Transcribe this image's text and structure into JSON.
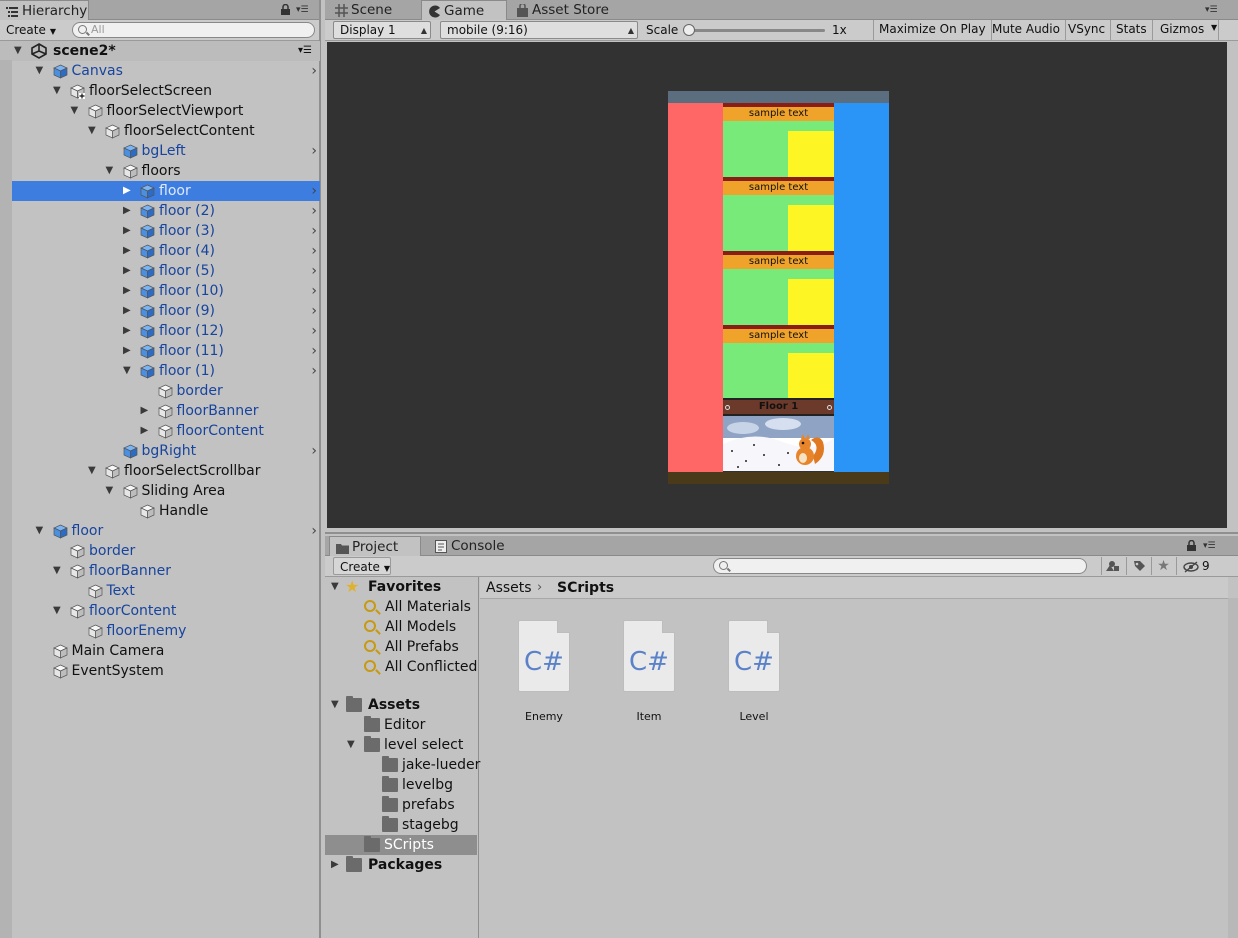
{
  "hierarchy": {
    "tab_label": "Hierarchy",
    "create_label": "Create",
    "search_placeholder": "All",
    "scene_name": "scene2*",
    "items": [
      {
        "label": "Canvas",
        "indent": 1,
        "fold": "open",
        "icon": "cube-blue",
        "prefab": true,
        "chev": true
      },
      {
        "label": "floorSelectScreen",
        "indent": 2,
        "fold": "open",
        "icon": "cube-gray-plus",
        "prefab": false,
        "chev": false
      },
      {
        "label": "floorSelectViewport",
        "indent": 3,
        "fold": "open",
        "icon": "cube-gray",
        "prefab": false,
        "chev": false
      },
      {
        "label": "floorSelectContent",
        "indent": 4,
        "fold": "open",
        "icon": "cube-gray",
        "prefab": false,
        "chev": false
      },
      {
        "label": "bgLeft",
        "indent": 5,
        "fold": "none",
        "icon": "cube-blue",
        "prefab": true,
        "chev": true
      },
      {
        "label": "floors",
        "indent": 5,
        "fold": "open",
        "icon": "cube-gray",
        "prefab": false,
        "chev": false
      },
      {
        "label": "floor",
        "indent": 6,
        "fold": "closed",
        "icon": "cube-blue",
        "prefab": true,
        "chev": true,
        "selected": true
      },
      {
        "label": "floor (2)",
        "indent": 6,
        "fold": "closed",
        "icon": "cube-blue",
        "prefab": true,
        "chev": true
      },
      {
        "label": "floor (3)",
        "indent": 6,
        "fold": "closed",
        "icon": "cube-blue",
        "prefab": true,
        "chev": true
      },
      {
        "label": "floor (4)",
        "indent": 6,
        "fold": "closed",
        "icon": "cube-blue",
        "prefab": true,
        "chev": true
      },
      {
        "label": "floor (5)",
        "indent": 6,
        "fold": "closed",
        "icon": "cube-blue",
        "prefab": true,
        "chev": true
      },
      {
        "label": "floor (10)",
        "indent": 6,
        "fold": "closed",
        "icon": "cube-blue",
        "prefab": true,
        "chev": true
      },
      {
        "label": "floor (9)",
        "indent": 6,
        "fold": "closed",
        "icon": "cube-blue",
        "prefab": true,
        "chev": true
      },
      {
        "label": "floor (12)",
        "indent": 6,
        "fold": "closed",
        "icon": "cube-blue",
        "prefab": true,
        "chev": true
      },
      {
        "label": "floor (11)",
        "indent": 6,
        "fold": "closed",
        "icon": "cube-blue",
        "prefab": true,
        "chev": true
      },
      {
        "label": "floor (1)",
        "indent": 6,
        "fold": "open",
        "icon": "cube-blue",
        "prefab": true,
        "chev": true
      },
      {
        "label": "border",
        "indent": 7,
        "fold": "none",
        "icon": "cube-gray",
        "prefab": true,
        "chev": false
      },
      {
        "label": "floorBanner",
        "indent": 7,
        "fold": "closed",
        "icon": "cube-gray",
        "prefab": true,
        "chev": false
      },
      {
        "label": "floorContent",
        "indent": 7,
        "fold": "closed",
        "icon": "cube-gray",
        "prefab": true,
        "chev": false
      },
      {
        "label": "bgRight",
        "indent": 5,
        "fold": "none",
        "icon": "cube-blue",
        "prefab": true,
        "chev": true
      },
      {
        "label": "floorSelectScrollbar",
        "indent": 4,
        "fold": "open",
        "icon": "cube-gray",
        "prefab": false,
        "chev": false
      },
      {
        "label": "Sliding Area",
        "indent": 5,
        "fold": "open",
        "icon": "cube-gray",
        "prefab": false,
        "chev": false
      },
      {
        "label": "Handle",
        "indent": 6,
        "fold": "none",
        "icon": "cube-gray",
        "prefab": false,
        "chev": false
      },
      {
        "label": "floor",
        "indent": 1,
        "fold": "open",
        "icon": "cube-blue",
        "prefab": true,
        "chev": true
      },
      {
        "label": "border",
        "indent": 2,
        "fold": "none",
        "icon": "cube-gray",
        "prefab": true,
        "chev": false
      },
      {
        "label": "floorBanner",
        "indent": 2,
        "fold": "open",
        "icon": "cube-gray",
        "prefab": true,
        "chev": false
      },
      {
        "label": "Text",
        "indent": 3,
        "fold": "none",
        "icon": "cube-gray",
        "prefab": true,
        "chev": false
      },
      {
        "label": "floorContent",
        "indent": 2,
        "fold": "open",
        "icon": "cube-gray",
        "prefab": true,
        "chev": false
      },
      {
        "label": "floorEnemy",
        "indent": 3,
        "fold": "none",
        "icon": "cube-gray",
        "prefab": true,
        "chev": false
      },
      {
        "label": "Main Camera",
        "indent": 1,
        "fold": "none",
        "icon": "cube-gray",
        "prefab": false,
        "chev": false
      },
      {
        "label": "EventSystem",
        "indent": 1,
        "fold": "none",
        "icon": "cube-gray",
        "prefab": false,
        "chev": false
      }
    ]
  },
  "game_view": {
    "tabs": [
      {
        "label": "Scene",
        "icon": "grid-icon",
        "active": false
      },
      {
        "label": "Game",
        "icon": "pacman-icon",
        "active": true
      },
      {
        "label": "Asset Store",
        "icon": "bag-icon",
        "active": false
      }
    ],
    "display_label": "Display 1",
    "aspect_label": "mobile (9:16)",
    "scale_label": "Scale",
    "scale_value": "1x",
    "scale_fraction": 0.0,
    "buttons": [
      "Maximize On Play",
      "Mute Audio",
      "VSync",
      "Stats",
      "Gizmos"
    ],
    "sample_texts": [
      "sample text",
      "sample text",
      "sample text",
      "sample text"
    ],
    "floor_banner": "Floor 1",
    "colors": {
      "left": "#ff6666",
      "right": "#2b95f7",
      "green": "#77ea7a",
      "yellow": "#fdf624",
      "orange": "#f0a32a",
      "darkred": "#8a1e16",
      "header": "#5a6e7f",
      "footer": "#4a3a1a",
      "viewport": "#323232"
    }
  },
  "project": {
    "tabs": [
      {
        "label": "Project",
        "icon": "folder-icon",
        "active": true
      },
      {
        "label": "Console",
        "icon": "console-icon",
        "active": false
      }
    ],
    "create_label": "Create",
    "hidden_count": "9",
    "favorites_label": "Favorites",
    "favorites": [
      "All Materials",
      "All Models",
      "All Prefabs",
      "All Conflicted"
    ],
    "assets_label": "Assets",
    "tree": [
      {
        "label": "Editor",
        "indent": 1,
        "fold": "none"
      },
      {
        "label": "level select",
        "indent": 1,
        "fold": "open"
      },
      {
        "label": "jake-lueder",
        "indent": 2,
        "fold": "none"
      },
      {
        "label": "levelbg",
        "indent": 2,
        "fold": "none"
      },
      {
        "label": "prefabs",
        "indent": 2,
        "fold": "none"
      },
      {
        "label": "stagebg",
        "indent": 2,
        "fold": "none"
      },
      {
        "label": "SCripts",
        "indent": 1,
        "fold": "none",
        "selected": true
      }
    ],
    "packages_label": "Packages",
    "breadcrumb": [
      "Assets",
      "SCripts"
    ],
    "files": [
      {
        "name": "Enemy",
        "glyph": "C#"
      },
      {
        "name": "Item",
        "glyph": "C#"
      },
      {
        "name": "Level",
        "glyph": "C#"
      }
    ]
  }
}
